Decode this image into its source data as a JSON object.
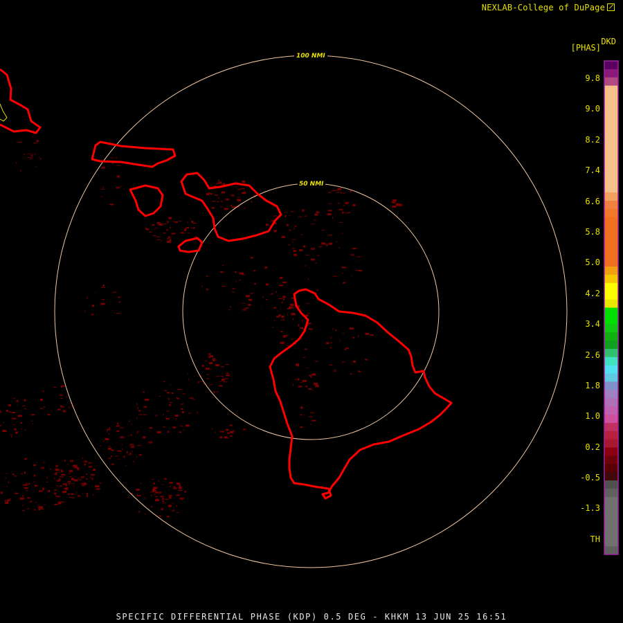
{
  "credit": "NEXLAB-College of DuPage",
  "product_code": "DKD",
  "unit_label": "[PHAS]",
  "bottom_title": "SPECIFIC DIFFERENTIAL PHASE (KDP) 0.5 DEG - KHKM 13 JUN 25 16:51",
  "rings": [
    {
      "label": "50 NMI"
    },
    {
      "label": "100 NMI"
    }
  ],
  "scale": {
    "labels": [
      "9.8",
      "9.0",
      "8.2",
      "7.4",
      "6.6",
      "5.8",
      "5.0",
      "4.2",
      "3.4",
      "2.6",
      "1.8",
      "1.0",
      "0.2",
      "-0.5",
      "-1.3",
      "TH"
    ],
    "colors": [
      "#5a0060",
      "#8a1a7a",
      "#b04a80",
      "#f6c08a",
      "#f6c08a",
      "#f6c08a",
      "#f6c08a",
      "#f6c08a",
      "#f6c08a",
      "#f6c08a",
      "#f6c08a",
      "#f6c08a",
      "#f6c08a",
      "#f6c08a",
      "#f6c08a",
      "#f6c08a",
      "#f4a060",
      "#f08040",
      "#f07828",
      "#f07020",
      "#f07020",
      "#f07020",
      "#f07020",
      "#f07020",
      "#f07020",
      "#f0a010",
      "#f6c800",
      "#ffff00",
      "#ffff00",
      "#e8e800",
      "#00e000",
      "#00e000",
      "#10c810",
      "#10b010",
      "#10a020",
      "#30c070",
      "#40e0c0",
      "#50e0f0",
      "#60c8e0",
      "#8090c8",
      "#a080c0",
      "#b070b8",
      "#c060b0",
      "#d050a0",
      "#c03060",
      "#b82040",
      "#a81830",
      "#8a0010",
      "#6e0008",
      "#580000",
      "#400808",
      "#505050",
      "#606060",
      "#707070",
      "#707070",
      "#707070",
      "#707070",
      "#707070",
      "#707070",
      "#606060"
    ]
  },
  "colors": {
    "coastline": "#ff0000",
    "ring": "#f0c8a0",
    "echo": "#7a0000",
    "text": "#e8e000"
  }
}
